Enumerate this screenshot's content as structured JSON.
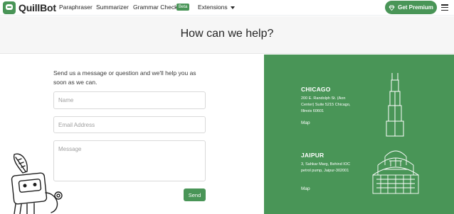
{
  "nav": {
    "brand": "QuillBot",
    "links": [
      "Paraphraser",
      "Summarizer",
      "Grammar Checker",
      "Extensions"
    ],
    "beta_badge": "Beta",
    "premium_button": "Get Premium",
    "premium_icon": "diamond-icon",
    "menu_icon": "hamburger-icon"
  },
  "hero": {
    "title": "How can we help?"
  },
  "form": {
    "intro": "Send us a message or question and we'll help you as soon as we can.",
    "name_placeholder": "Name",
    "email_placeholder": "Email Address",
    "message_placeholder": "Message",
    "send_label": "Send"
  },
  "offices": [
    {
      "city": "CHICAGO",
      "address": "200 E. Randolph St. (Aon Center) Suite 5215 Chicago, Illinois 60601",
      "map_label": "Map",
      "illustration": "skyscraper-icon"
    },
    {
      "city": "JAIPUR",
      "address": "3, Sahkar Marg, Behind IOC petrol pump, Jaipur-302001",
      "map_label": "Map",
      "illustration": "hawa-mahal-icon"
    }
  ],
  "colors": {
    "brand_green": "#499557",
    "hero_bg": "#f6f6f6",
    "text": "#252525"
  }
}
